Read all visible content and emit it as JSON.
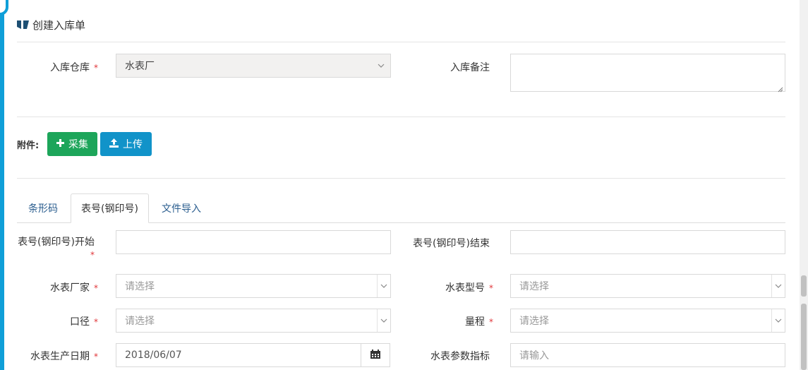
{
  "header": {
    "title": "创建入库单"
  },
  "form_top": {
    "warehouse_label": "入库仓库",
    "warehouse_value": "水表厂",
    "remark_label": "入库备注",
    "remark_value": ""
  },
  "attachments": {
    "label": "附件:",
    "collect_label": "采集",
    "upload_label": "上传"
  },
  "tabs": [
    {
      "label": "条形码",
      "active": false
    },
    {
      "label": "表号(钢印号)",
      "active": true
    },
    {
      "label": "文件导入",
      "active": false
    }
  ],
  "meter_form": {
    "start_label": "表号(钢印号)开始",
    "start_value": "",
    "end_label": "表号(钢印号)结束",
    "end_value": "",
    "maker_label": "水表厂家",
    "maker_placeholder": "请选择",
    "model_label": "水表型号",
    "model_placeholder": "请选择",
    "caliber_label": "口径",
    "caliber_placeholder": "请选择",
    "range_label": "量程",
    "range_placeholder": "请选择",
    "date_label": "水表生产日期",
    "date_value": "2018/06/07",
    "param_label": "水表参数指标",
    "param_placeholder": "请输入"
  },
  "required_mark": "*",
  "colors": {
    "accent": "#0f9fd8",
    "green_button": "#1da55a",
    "blue_button": "#1193c9",
    "required": "#e0363a"
  }
}
